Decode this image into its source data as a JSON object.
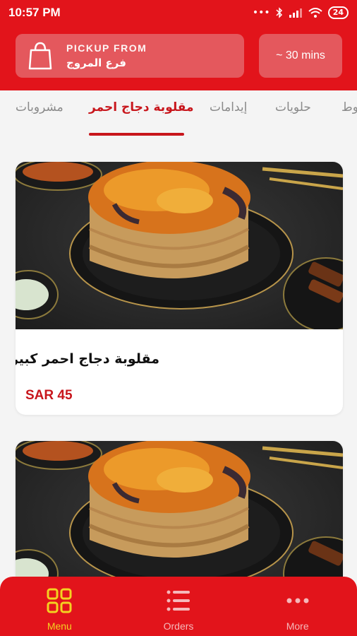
{
  "status_bar": {
    "time": "10:57 PM",
    "signal_dots": "•••",
    "battery": "24"
  },
  "header": {
    "pickup_label": "PICKUP FROM",
    "branch_name": "فرع المروج",
    "eta": "~ 30 mins"
  },
  "categories": {
    "items": [
      "مشروبات",
      "مقلوبة دجاج احمر",
      "إيدامات",
      "حلويات",
      "وط"
    ],
    "active": "مقلوبة دجاج احمر"
  },
  "products": [
    {
      "name": "مقلوبة دجاج احمر كبير",
      "price": "SAR 45"
    },
    {
      "name": "",
      "price": ""
    }
  ],
  "bottom_nav": {
    "items": [
      {
        "label": "Menu",
        "icon": "grid-icon",
        "active": true
      },
      {
        "label": "Orders",
        "icon": "list-icon",
        "active": false
      },
      {
        "label": "More",
        "icon": "more-dots-icon",
        "active": false
      }
    ]
  },
  "colors": {
    "brand_red": "#e2141b",
    "accent_red": "#c8161c",
    "active_nav": "#f3d221"
  }
}
